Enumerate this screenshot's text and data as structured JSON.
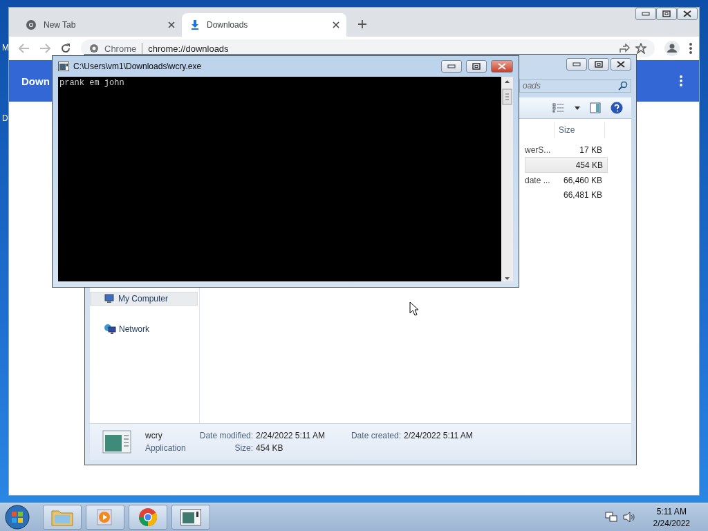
{
  "desktop": {
    "icon_labels": [
      "M",
      "D"
    ]
  },
  "browser": {
    "tabs": [
      {
        "title": "New Tab",
        "selected": false
      },
      {
        "title": "Downloads",
        "selected": true
      }
    ],
    "address": {
      "origin": "Chrome",
      "url": "chrome://downloads"
    },
    "header": {
      "title": "Down"
    }
  },
  "explorer": {
    "search": {
      "placeholder": "oads"
    },
    "columns": [
      "Size"
    ],
    "rows": [
      {
        "name": "werS...",
        "size": "17 KB",
        "selected": false
      },
      {
        "size": "454 KB",
        "selected": true
      },
      {
        "name": "date ...",
        "size": "66,460 KB",
        "selected": false
      },
      {
        "size": "66,481 KB",
        "selected": false
      }
    ],
    "nav": [
      {
        "label": "My Computer",
        "selected": true
      },
      {
        "label": "Network",
        "selected": false
      }
    ],
    "details": {
      "name": "wcry",
      "type": "Application",
      "fields": [
        {
          "label": "Date modified:",
          "value": "2/24/2022 5:11 AM"
        },
        {
          "label": "Size:",
          "value": "454 KB"
        },
        {
          "label": "Date created:",
          "value": "2/24/2022 5:11 AM"
        }
      ]
    }
  },
  "console": {
    "title": "C:\\Users\\vm1\\Downloads\\wcry.exe",
    "output": "prank em john"
  },
  "taskbar": {
    "time": "5:11 AM",
    "date": "2/24/2022"
  }
}
